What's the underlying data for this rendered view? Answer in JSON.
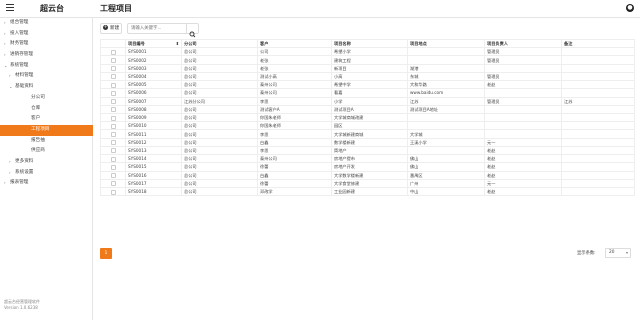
{
  "app": {
    "name": "超云台",
    "page_title": "工程项目"
  },
  "sidebar": {
    "items": [
      {
        "label": "组合管理",
        "arrow": "›",
        "level": 0,
        "active": false
      },
      {
        "label": "投入管理",
        "arrow": "›",
        "level": 0,
        "active": false
      },
      {
        "label": "财务管理",
        "arrow": "›",
        "level": 0,
        "active": false
      },
      {
        "label": "进销存管理",
        "arrow": "›",
        "level": 0,
        "active": false
      },
      {
        "label": "系统管理",
        "arrow": "⌄",
        "level": 0,
        "active": false
      },
      {
        "label": "材料管理",
        "arrow": "›",
        "level": 1,
        "active": false
      },
      {
        "label": "基础资料",
        "arrow": "⌄",
        "level": 1,
        "active": false
      },
      {
        "label": "分公司",
        "arrow": "",
        "level": 2,
        "active": false
      },
      {
        "label": "仓库",
        "arrow": "",
        "level": 2,
        "active": false
      },
      {
        "label": "客户",
        "arrow": "",
        "level": 2,
        "active": false
      },
      {
        "label": "工程项目",
        "arrow": "",
        "level": 2,
        "active": true
      },
      {
        "label": "报告抽",
        "arrow": "",
        "level": 2,
        "active": false
      },
      {
        "label": "供应商",
        "arrow": "",
        "level": 2,
        "active": false
      },
      {
        "label": "更多资料",
        "arrow": "›",
        "level": 1,
        "active": false
      },
      {
        "label": "系统设置",
        "arrow": "›",
        "level": 1,
        "active": false
      },
      {
        "label": "报表管理",
        "arrow": "›",
        "level": 0,
        "active": false
      }
    ],
    "footer_line1": "超云台经营管理软件",
    "footer_line2": "Version 1.0.6238"
  },
  "toolbar": {
    "new_label": "新建",
    "new_icon": "plus-icon",
    "search_placeholder": "请输入关键字...",
    "search_icon": "search-icon"
  },
  "table": {
    "columns": [
      "项目编号",
      "分公司",
      "客户",
      "项目名称",
      "项目地点",
      "项目负责人",
      "备注"
    ],
    "sort_column": "项目编号",
    "rows": [
      [
        "SYS0001",
        "总公司",
        "公司",
        "希望小学",
        "",
        "管理员",
        ""
      ],
      [
        "SYS0002",
        "总公司",
        "老张",
        "建筑工程",
        "",
        "管理员",
        ""
      ],
      [
        "SYS0003",
        "总公司",
        "老张",
        "新项目",
        "湖港",
        "",
        ""
      ],
      [
        "SYS0004",
        "总公司",
        "测试小高",
        "小高",
        "东城",
        "管理员",
        ""
      ],
      [
        "SYS0005",
        "总公司",
        "泰州公司",
        "希望中学",
        "大和华路",
        "老赵",
        ""
      ],
      [
        "SYS0006",
        "总公司",
        "泰州公司",
        "看嘉",
        "www.baidu.com",
        "",
        ""
      ],
      [
        "SYS0007",
        "江苏分公司",
        "李思",
        "小学",
        "江苏",
        "管理员",
        "江苏"
      ],
      [
        "SYS0008",
        "总公司",
        "测试客户A",
        "测试项目A",
        "测试项目A地址",
        "",
        ""
      ],
      [
        "SYS0009",
        "总公司",
        "你国朱老师",
        "大学城商城改建",
        "",
        "",
        ""
      ],
      [
        "SYS0010",
        "总公司",
        "你国朱老师",
        "园区",
        "",
        "",
        ""
      ],
      [
        "SYS0011",
        "总公司",
        "李思",
        "大学城新建商城",
        "大学城",
        "",
        ""
      ],
      [
        "SYS0012",
        "总公司",
        "白鑫",
        "数学楼新建",
        "王溪小学",
        "元一",
        ""
      ],
      [
        "SYS0013",
        "总公司",
        "李思",
        "筒地产",
        "",
        "老赵",
        ""
      ],
      [
        "SYS0014",
        "总公司",
        "泰州公司",
        "房地产提市",
        "佛山",
        "老赵",
        ""
      ],
      [
        "SYS0015",
        "总公司",
        "徐蕾",
        "房地产开发",
        "佛山",
        "老赵",
        ""
      ],
      [
        "SYS0016",
        "总公司",
        "白鑫",
        "大学数学楼新建",
        "番禺区",
        "老赵",
        ""
      ],
      [
        "SYS0017",
        "总公司",
        "徐蕾",
        "大学食堂修建",
        "广州",
        "元一",
        ""
      ],
      [
        "SYS0018",
        "总公司",
        "邓改学",
        "工业园新建",
        "中山",
        "老赵",
        ""
      ]
    ]
  },
  "pager": {
    "current_page": "1",
    "page_size_label": "显示条数:",
    "page_size": "20"
  }
}
